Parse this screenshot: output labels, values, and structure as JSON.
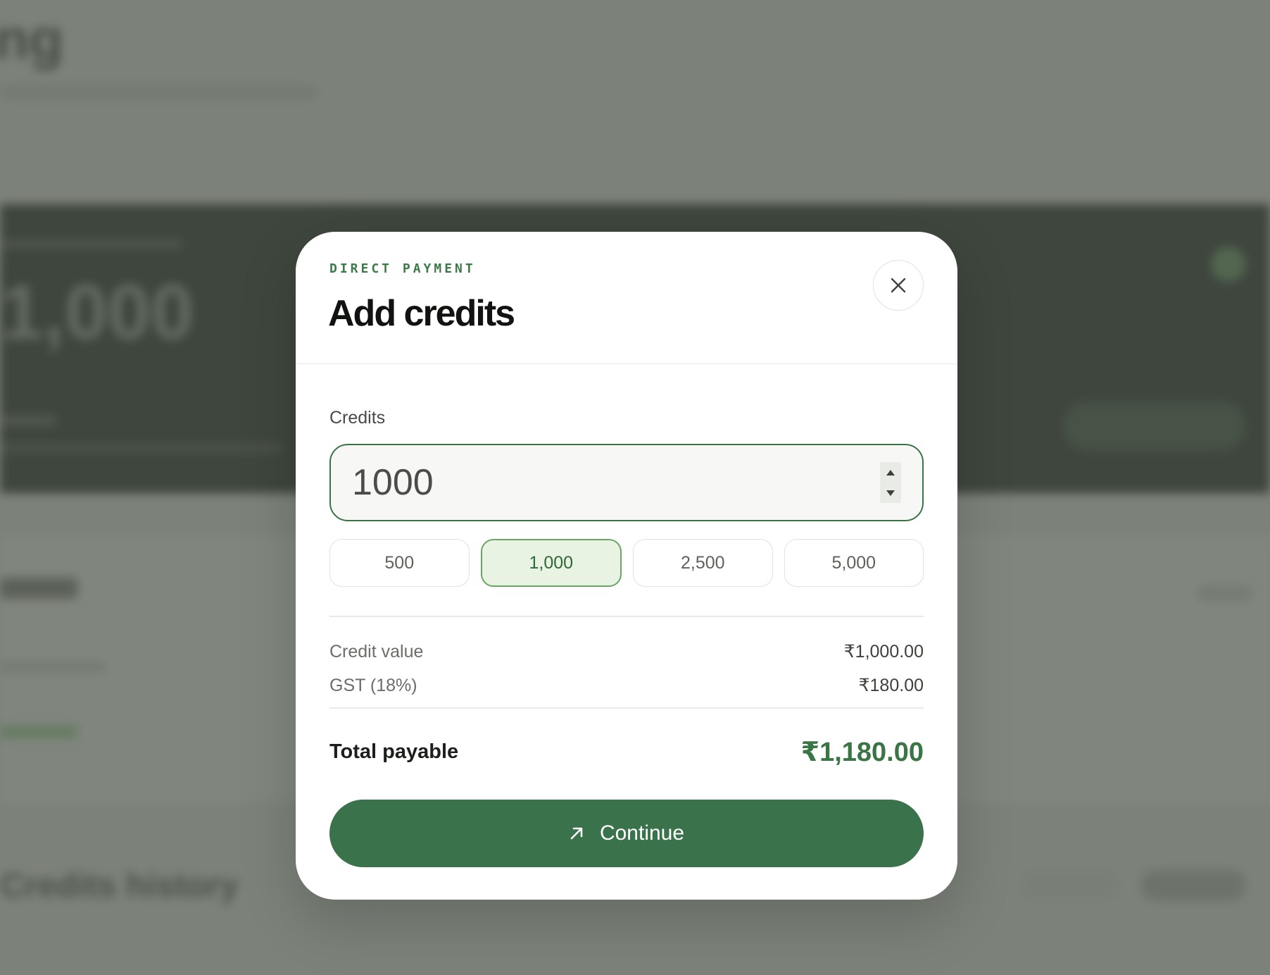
{
  "background": {
    "page_title_fragment": "ing",
    "balance_fragment": "1,000",
    "history_title_fragment": "Credits history"
  },
  "modal": {
    "eyebrow": "DIRECT PAYMENT",
    "title": "Add credits",
    "close_icon": "close-icon",
    "credits_field": {
      "label": "Credits",
      "value": "1000"
    },
    "presets": [
      {
        "label": "500",
        "selected": false
      },
      {
        "label": "1,000",
        "selected": true
      },
      {
        "label": "2,500",
        "selected": false
      },
      {
        "label": "5,000",
        "selected": false
      }
    ],
    "summary": {
      "credit_value_label": "Credit value",
      "credit_value": "₹1,000.00",
      "gst_label": "GST (18%)",
      "gst_value": "₹180.00",
      "total_label": "Total payable",
      "total_value": "₹1,180.00"
    },
    "continue_button": {
      "label": "Continue",
      "icon": "arrow-up-right-icon"
    }
  },
  "colors": {
    "accent": "#3a724b",
    "accent_text": "#3b7445",
    "selected_bg": "#e9f3e4",
    "overlay": "#7f847d"
  }
}
